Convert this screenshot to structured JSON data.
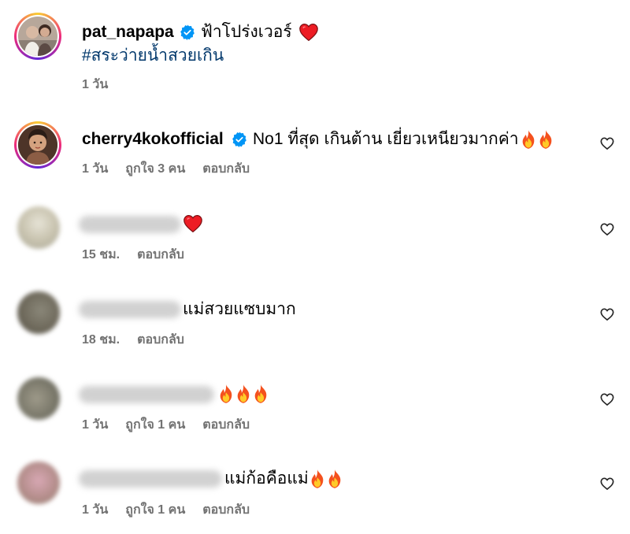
{
  "post": {
    "username": "pat_napapa",
    "caption_text": "ฟ้าโปร่งเวอร์",
    "hashtag": "#สระว่ายน้ำสวยเกิน",
    "time": "1 วัน"
  },
  "comments": [
    {
      "username": "cherry4kokofficial",
      "verified": true,
      "text": "No1 ที่สุด เกินต้าน เยี่ยวเหนียวมากค่า",
      "emojis": [
        "fire",
        "fire"
      ],
      "time": "1 วัน",
      "likes": "ถูกใจ 3 คน",
      "reply": "ตอบกลับ"
    },
    {
      "username": "",
      "text": "",
      "emojis": [
        "red-heart"
      ],
      "time": "15 ชม.",
      "likes": "",
      "reply": "ตอบกลับ"
    },
    {
      "username": "",
      "text": "แม่สวยแซบมาก",
      "emojis": [],
      "time": "18 ชม.",
      "likes": "",
      "reply": "ตอบกลับ"
    },
    {
      "username": "",
      "text": "",
      "emojis": [
        "fire",
        "fire",
        "fire"
      ],
      "time": "1 วัน",
      "likes": "ถูกใจ 1 คน",
      "reply": "ตอบกลับ"
    },
    {
      "username": "",
      "text": "แม่ก้อคือแม่",
      "emojis": [
        "fire",
        "fire"
      ],
      "time": "1 วัน",
      "likes": "ถูกใจ 1 คน",
      "reply": "ตอบกลับ"
    }
  ],
  "colors": {
    "verified_blue": "#0095f6",
    "heart_red": "#ed1c24",
    "meta_gray": "#737373",
    "hashtag_blue": "#00376b"
  }
}
